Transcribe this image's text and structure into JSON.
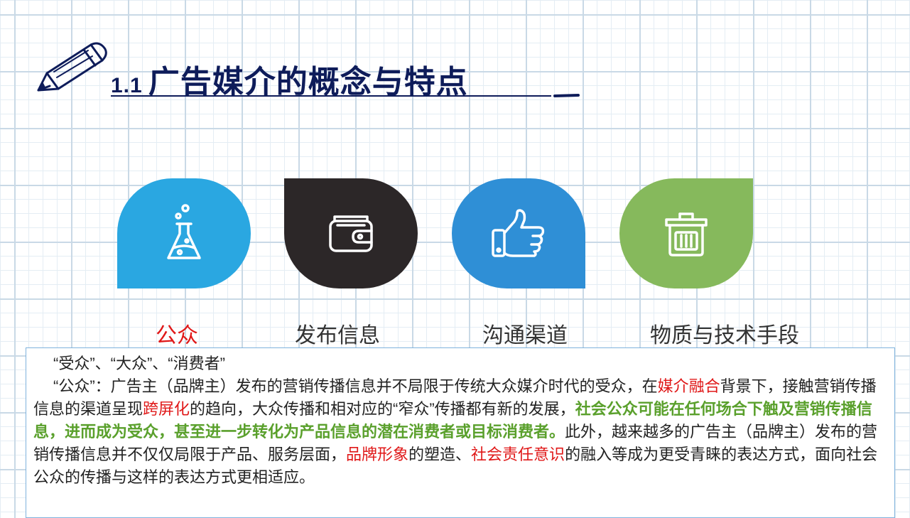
{
  "title": {
    "number": "1.1",
    "text": "广告媒介的概念与特点"
  },
  "features": [
    {
      "label": "公众",
      "icon": "flask-icon",
      "color": "#2aa7e1"
    },
    {
      "label": "发布信息",
      "icon": "wallet-icon",
      "color": "#2c2728"
    },
    {
      "label": "沟通渠道",
      "icon": "thumbs-up-icon",
      "color": "#2f8fd6"
    },
    {
      "label": "物质与技术手段",
      "icon": "trash-bin-icon",
      "color": "#86b95c"
    }
  ],
  "body": {
    "line1": "“受众”、“大众”、“消费者”",
    "p1": "“公众”：广告主（品牌主）发布的营销传播信息并不局限于传统大众媒介时代的受众，在",
    "p2": "媒介融合",
    "p3": "背景下，接触营销传播信息的渠道呈现",
    "p4": "跨屏化",
    "p5": "的趋向，大众传播和相对应的“窄众”传播都有新的发展，",
    "p6": "社会公众可能在任何场合下触及营销传播信息，进而成为受众，甚至进一步转化为产品信息的潜在消费者或目标消费者。",
    "p7": "此外，越来越多的广告主（品牌主）发布的营销传播信息并不仅仅局限于产品、服务层面，",
    "p8": "品牌形象",
    "p9": "的塑造、",
    "p10": "社会责任意识",
    "p11": "的融入等成为更受青睐的表达方式，面向社会公众的传播与这样的表达方式更相适应。"
  },
  "colors": {
    "highlight_red": "#e01818",
    "highlight_green": "#5aa02c",
    "title": "#0e1c5a"
  }
}
